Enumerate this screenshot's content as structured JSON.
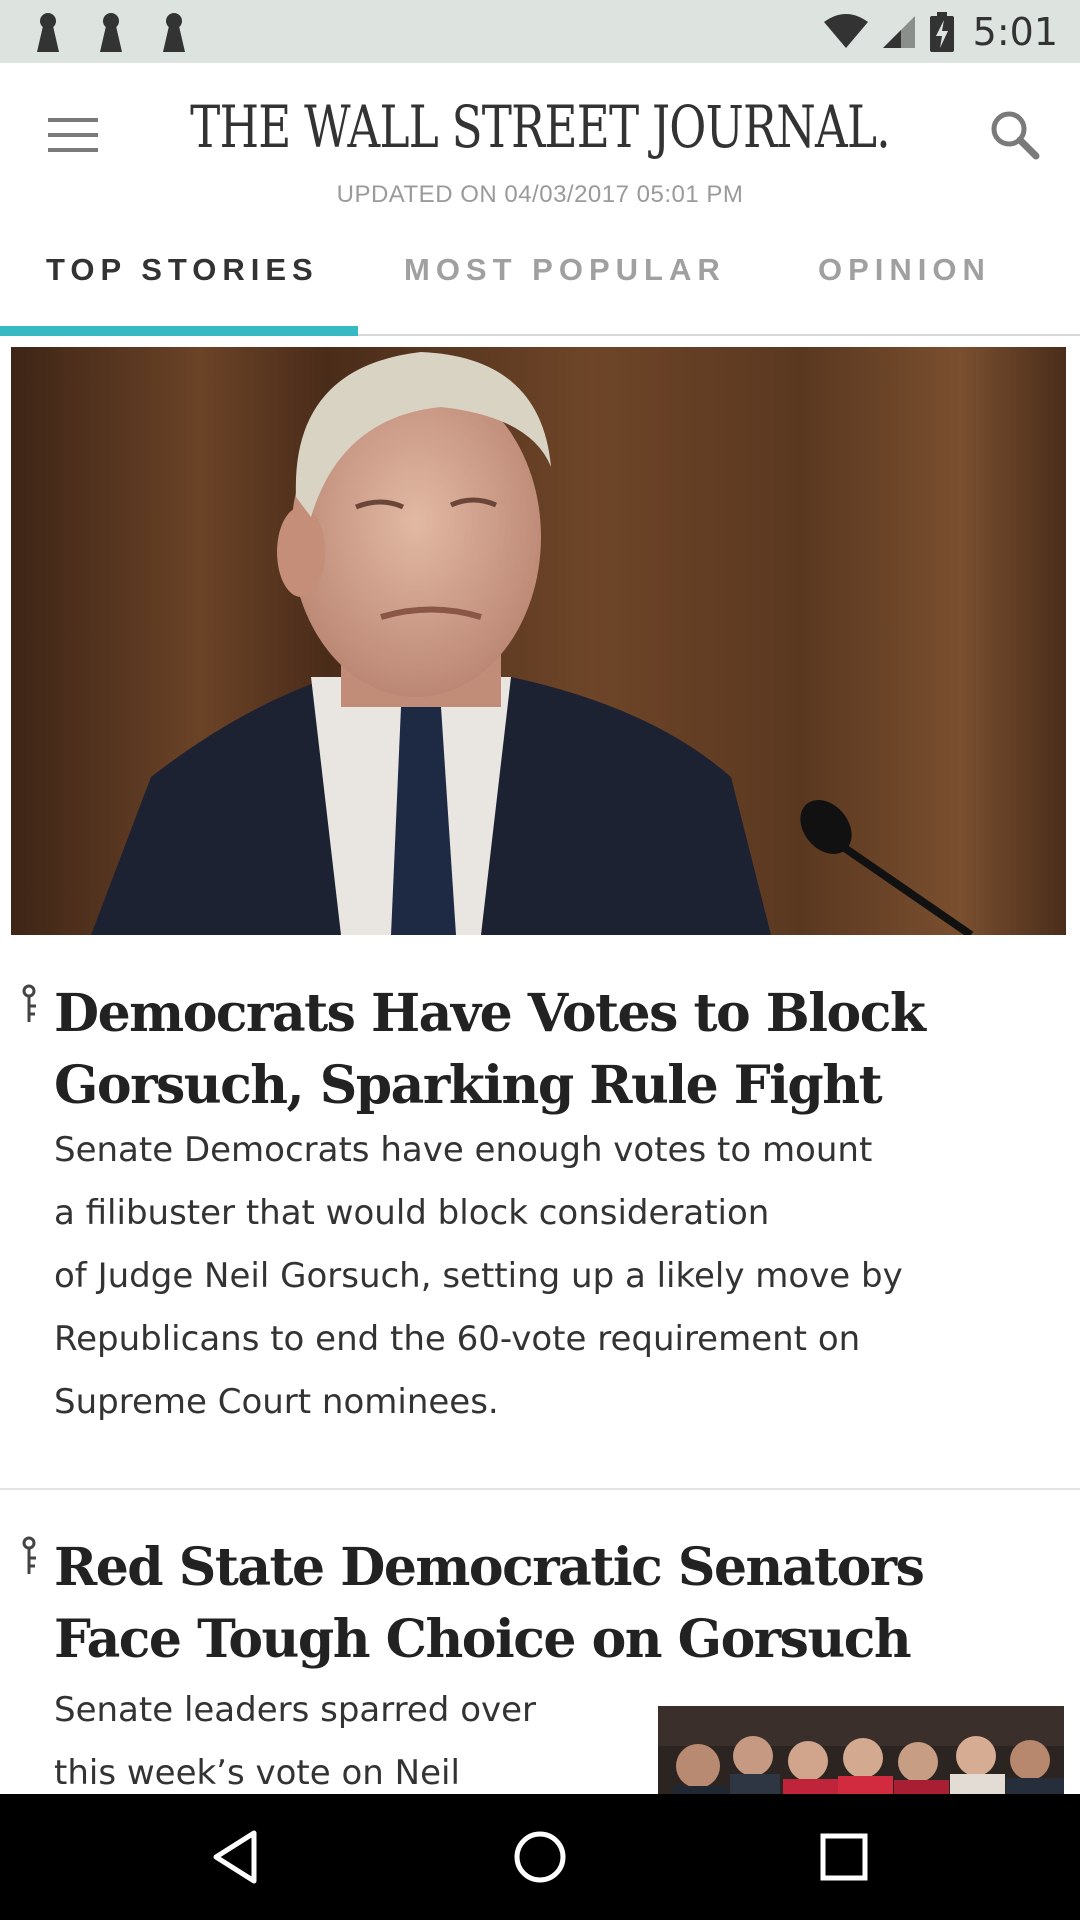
{
  "status_bar": {
    "time": "5:01",
    "notification_icons": [
      "keyhole-icon",
      "keyhole-icon",
      "keyhole-icon"
    ],
    "system_icons": [
      "wifi-icon",
      "cell-signal-icon",
      "battery-charging-icon"
    ]
  },
  "header": {
    "masthead": "THE WALL STREET JOURNAL.",
    "updated": "UPDATED ON 04/03/2017 05:01 PM",
    "menu_icon": "menu-icon",
    "search_icon": "search-icon"
  },
  "tabs": [
    {
      "label": "TOP STORIES",
      "active": true
    },
    {
      "label": "MOST POPULAR",
      "active": false
    },
    {
      "label": "OPINION",
      "active": false
    }
  ],
  "colors": {
    "accent": "#37b9c4",
    "status_bar": "#dde3df",
    "text_dark": "#222222",
    "text_muted": "#a0a0a0"
  },
  "articles": [
    {
      "headline": "Democrats Have Votes to Block Gorsuch, Sparking Rule Fight",
      "summary_lines": [
        "Senate Democrats have enough votes to mount",
        "a filibuster that would block consideration",
        "of Judge Neil Gorsuch, setting up a likely move by",
        "Republicans to end the 60-vote requirement on",
        "Supreme Court nominees."
      ],
      "icon": "key-icon"
    },
    {
      "headline": "Red State Democratic Senators Face Tough Choice on Gorsuch",
      "summary_lines": [
        "Senate leaders sparred over",
        "this week’s vote on Neil"
      ],
      "icon": "key-icon"
    }
  ],
  "nav_bar": {
    "buttons": [
      "back-icon",
      "home-icon",
      "recents-icon"
    ]
  }
}
